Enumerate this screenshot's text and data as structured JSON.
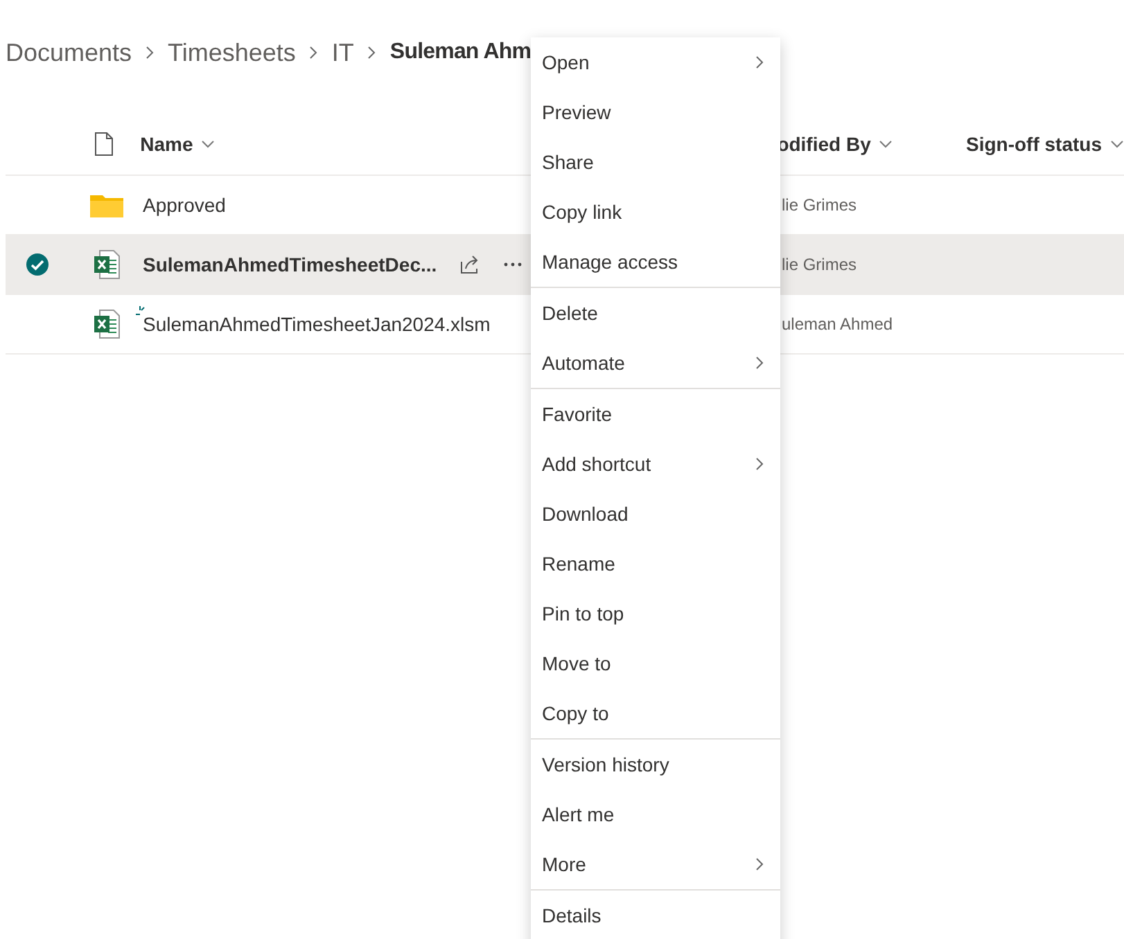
{
  "breadcrumb": [
    {
      "label": "Documents",
      "current": false
    },
    {
      "label": "Timesheets",
      "current": false
    },
    {
      "label": "IT",
      "current": false
    },
    {
      "label": "Suleman Ahm",
      "current": true
    }
  ],
  "table": {
    "columns": [
      {
        "kind": "icon"
      },
      {
        "kind": "text",
        "label": "Name"
      },
      {
        "kind": "text",
        "label": "odified By"
      },
      {
        "kind": "text",
        "label": "Sign-off status"
      }
    ],
    "rows": [
      {
        "kind": "folder",
        "name": "Approved",
        "modified_by": "lie Grimes",
        "selected": false,
        "new": false
      },
      {
        "kind": "excel",
        "name": "SulemanAhmedTimesheetDec...",
        "modified_by": "lie Grimes",
        "selected": true,
        "new": false
      },
      {
        "kind": "excel",
        "name": "SulemanAhmedTimesheetJan2024.xlsm",
        "modified_by": "uleman Ahmed",
        "selected": false,
        "new": true
      }
    ]
  },
  "context_menu": {
    "groups": [
      [
        {
          "label": "Open",
          "submenu": true
        },
        {
          "label": "Preview",
          "submenu": false
        },
        {
          "label": "Share",
          "submenu": false
        },
        {
          "label": "Copy link",
          "submenu": false
        },
        {
          "label": "Manage access",
          "submenu": false
        }
      ],
      [
        {
          "label": "Delete",
          "submenu": false
        },
        {
          "label": "Automate",
          "submenu": true
        }
      ],
      [
        {
          "label": "Favorite",
          "submenu": false
        },
        {
          "label": "Add shortcut",
          "submenu": true
        },
        {
          "label": "Download",
          "submenu": false
        },
        {
          "label": "Rename",
          "submenu": false
        },
        {
          "label": "Pin to top",
          "submenu": false
        },
        {
          "label": "Move to",
          "submenu": false
        },
        {
          "label": "Copy to",
          "submenu": false
        }
      ],
      [
        {
          "label": "Version history",
          "submenu": false
        },
        {
          "label": "Alert me",
          "submenu": false
        },
        {
          "label": "More",
          "submenu": true
        }
      ],
      [
        {
          "label": "Details",
          "submenu": false
        }
      ]
    ]
  }
}
